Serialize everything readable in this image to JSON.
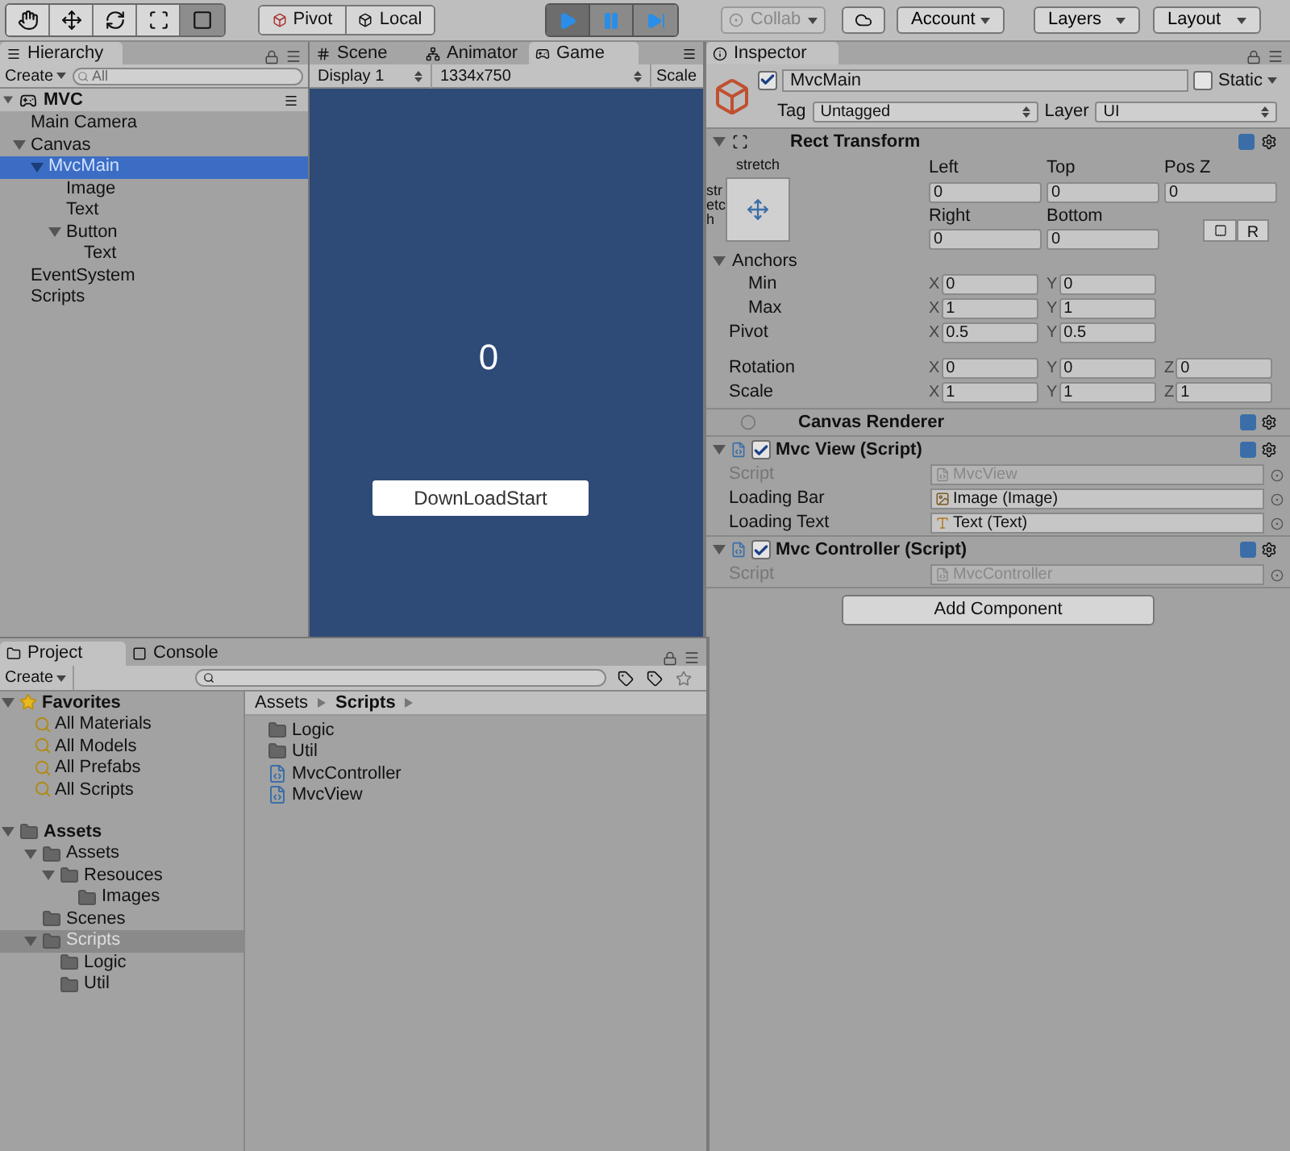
{
  "toolbar": {
    "tools": [
      {
        "kind": "hand",
        "selected": false
      },
      {
        "kind": "move",
        "selected": false
      },
      {
        "kind": "rotate",
        "selected": false
      },
      {
        "kind": "scale",
        "selected": false
      },
      {
        "kind": "rect",
        "selected": true
      }
    ],
    "pivot": "Pivot",
    "local": "Local",
    "playback": [
      {
        "kind": "play",
        "on": true
      },
      {
        "kind": "pause",
        "on": false
      },
      {
        "kind": "step",
        "on": false
      }
    ],
    "collab": "Collab",
    "account": "Account",
    "layers": "Layers",
    "layout": "Layout"
  },
  "hierarchy": {
    "tab": "Hierarchy",
    "create": "Create",
    "search_placeholder": "All",
    "scene": "MVC",
    "items": [
      {
        "label": "Main Camera",
        "selected": false
      },
      {
        "label": "Canvas",
        "selected": false,
        "expanded": true,
        "children": [
          {
            "label": "MvcMain",
            "selected": true,
            "expanded": true,
            "children": [
              {
                "label": "Image",
                "selected": false
              },
              {
                "label": "Text",
                "selected": false
              },
              {
                "label": "Button",
                "selected": false,
                "expanded": true,
                "children": [
                  {
                    "label": "Text",
                    "selected": false
                  }
                ]
              }
            ]
          }
        ]
      },
      {
        "label": "EventSystem",
        "selected": false
      },
      {
        "label": "Scripts",
        "selected": false
      }
    ]
  },
  "game": {
    "tabs": [
      {
        "label": "Scene",
        "selected": false
      },
      {
        "label": "Animator",
        "selected": false
      },
      {
        "label": "Game",
        "selected": true
      }
    ],
    "display": "Display 1",
    "resolution": "1334x750",
    "scale": "Scale",
    "counter": "0",
    "button": "DownLoadStart"
  },
  "inspector": {
    "tab": "Inspector",
    "object": {
      "active": true,
      "name": "MvcMain",
      "static": false,
      "static_label": "Static",
      "tag_label": "Tag",
      "tag": "Untagged",
      "layer_label": "Layer",
      "layer": "UI"
    },
    "rect_transform": {
      "title": "Rect Transform",
      "anchor_h": "stretch",
      "anchor_v": "stretch",
      "row1": [
        {
          "label": "Left",
          "value": "0"
        },
        {
          "label": "Top",
          "value": "0"
        },
        {
          "label": "Pos Z",
          "value": "0"
        }
      ],
      "row2": [
        {
          "label": "Right",
          "value": "0"
        },
        {
          "label": "Bottom",
          "value": "0"
        }
      ],
      "reset": "R",
      "anchors": {
        "label": "Anchors",
        "expanded": true,
        "rows": [
          {
            "label": "Min",
            "values": [
              {
                "axis": "X",
                "value": "0"
              },
              {
                "axis": "Y",
                "value": "0"
              }
            ]
          },
          {
            "label": "Max",
            "values": [
              {
                "axis": "X",
                "value": "1"
              },
              {
                "axis": "Y",
                "value": "1"
              }
            ]
          }
        ]
      },
      "pivot": {
        "label": "Pivot",
        "values": [
          {
            "axis": "X",
            "value": "0.5"
          },
          {
            "axis": "Y",
            "value": "0.5"
          }
        ]
      },
      "vectors": [
        {
          "label": "Rotation",
          "values": [
            {
              "axis": "X",
              "value": "0"
            },
            {
              "axis": "Y",
              "value": "0"
            },
            {
              "axis": "Z",
              "value": "0"
            }
          ]
        },
        {
          "label": "Scale",
          "values": [
            {
              "axis": "X",
              "value": "1"
            },
            {
              "axis": "Y",
              "value": "1"
            },
            {
              "axis": "Z",
              "value": "1"
            }
          ]
        }
      ]
    },
    "components": [
      {
        "kind": "renderer",
        "title": "Canvas Renderer"
      },
      {
        "kind": "script",
        "title": "Mvc View (Script)",
        "enabled": true,
        "expanded": true,
        "fields": [
          {
            "label": "Script",
            "value": "MvcView",
            "kind": "script",
            "disabled": true
          },
          {
            "label": "Loading Bar",
            "value": "Image (Image)",
            "kind": "image",
            "disabled": false
          },
          {
            "label": "Loading Text",
            "value": "Text (Text)",
            "kind": "text",
            "disabled": false
          }
        ]
      },
      {
        "kind": "script",
        "title": "Mvc Controller (Script)",
        "enabled": true,
        "expanded": true,
        "fields": [
          {
            "label": "Script",
            "value": "MvcController",
            "kind": "script",
            "disabled": true
          }
        ]
      }
    ],
    "add_component": "Add Component"
  },
  "project": {
    "tabs": [
      {
        "label": "Project",
        "selected": true
      },
      {
        "label": "Console",
        "selected": false
      }
    ],
    "create": "Create",
    "favorites": {
      "label": "Favorites",
      "expanded": true,
      "items": [
        "All Materials",
        "All Models",
        "All Prefabs",
        "All Scripts"
      ]
    },
    "assets": {
      "label": "Assets",
      "selected": false,
      "expanded": true,
      "children": [
        {
          "label": "Assets",
          "selected": false,
          "expanded": true,
          "children": [
            {
              "label": "Resouces",
              "selected": false,
              "expanded": true,
              "children": [
                {
                  "label": "Images",
                  "selected": false
                }
              ]
            }
          ]
        },
        {
          "label": "Scenes",
          "selected": false
        },
        {
          "label": "Scripts",
          "selected": true,
          "expanded": true,
          "children": [
            {
              "label": "Logic",
              "selected": false
            },
            {
              "label": "Util",
              "selected": false
            }
          ]
        }
      ]
    },
    "breadcrumb": [
      "Assets",
      "Scripts"
    ],
    "files": [
      {
        "name": "Logic",
        "kind": "folder"
      },
      {
        "name": "Util",
        "kind": "folder"
      },
      {
        "name": "MvcController",
        "kind": "script"
      },
      {
        "name": "MvcView",
        "kind": "script"
      }
    ]
  }
}
